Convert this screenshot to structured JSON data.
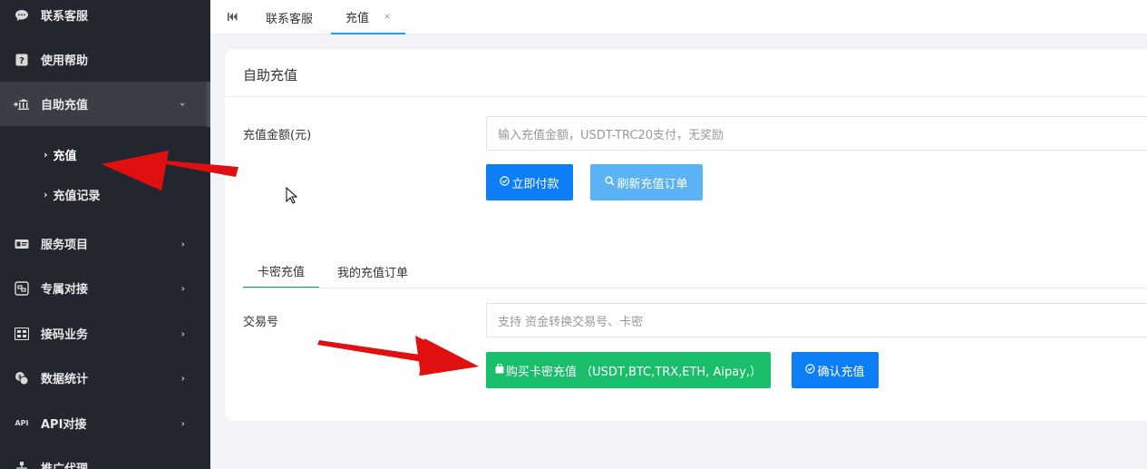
{
  "sidebar": {
    "items": [
      {
        "label": "联系客服",
        "icon": "chat-bubble-icon"
      },
      {
        "label": "使用帮助",
        "icon": "question-icon"
      },
      {
        "label": "自助充值",
        "icon": "bank-icon"
      },
      {
        "label": "服务项目",
        "icon": "card-icon"
      },
      {
        "label": "专属对接",
        "icon": "link-doc-icon"
      },
      {
        "label": "接码业务",
        "icon": "code-icon"
      },
      {
        "label": "数据统计",
        "icon": "coins-icon"
      },
      {
        "label": "API对接",
        "icon": "api-icon"
      },
      {
        "label": "推广代理",
        "icon": "network-icon"
      }
    ],
    "api_icon_text": "API",
    "submenu": [
      {
        "label": "充值"
      },
      {
        "label": "充值记录"
      }
    ]
  },
  "tabs": {
    "items": [
      {
        "label": "联系客服"
      },
      {
        "label": "充值"
      }
    ],
    "close_glyph": "×"
  },
  "card": {
    "title": "自助充值",
    "amount_label": "充值金额(元)",
    "amount_placeholder": "输入充值金额，USDT-TRC20支付，无奖励",
    "pay_button": "立即付款",
    "refresh_button": "刷新充值订单",
    "subtabs": [
      {
        "label": "卡密充值"
      },
      {
        "label": "我的充值订单"
      }
    ],
    "tx_label": "交易号",
    "tx_placeholder": "支持 资金转换交易号、卡密",
    "buy_button": "购买卡密充值 （USDT,BTC,TRX,ETH, Aipay,）",
    "confirm_button": "确认充值"
  },
  "colors": {
    "sidebar_bg": "#23262e",
    "primary_blue": "#0d7ef5",
    "light_blue": "#5bb3f5",
    "green": "#19be6b",
    "annotation_red": "#e01010"
  }
}
